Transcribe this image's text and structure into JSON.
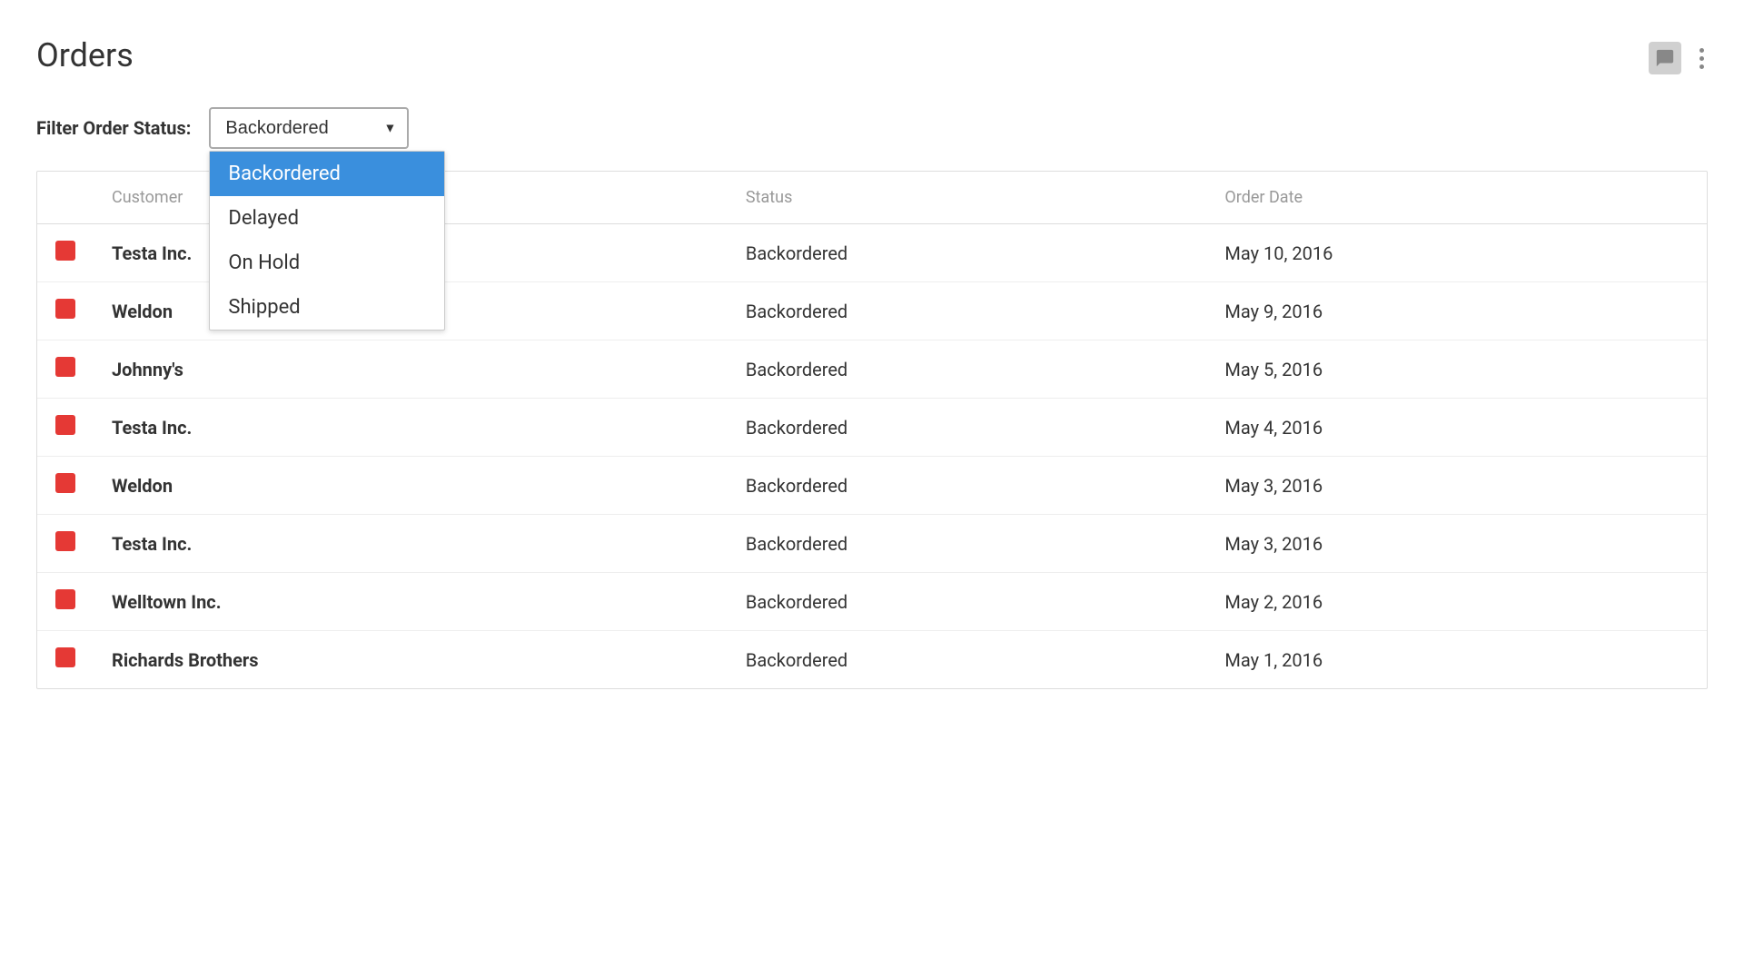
{
  "page": {
    "title": "Orders"
  },
  "header": {
    "chat_icon_label": "chat",
    "more_icon_label": "more options"
  },
  "filter": {
    "label": "Filter Order Status:",
    "selected_value": "Backordered",
    "options": [
      {
        "value": "Backordered",
        "label": "Backordered",
        "selected": true
      },
      {
        "value": "Delayed",
        "label": "Delayed",
        "selected": false
      },
      {
        "value": "On Hold",
        "label": "On Hold",
        "selected": false
      },
      {
        "value": "Shipped",
        "label": "Shipped",
        "selected": false
      }
    ]
  },
  "table": {
    "columns": [
      {
        "key": "indicator",
        "label": ""
      },
      {
        "key": "customer",
        "label": "Customer"
      },
      {
        "key": "status",
        "label": "Status"
      },
      {
        "key": "order_date",
        "label": "Order Date"
      }
    ],
    "rows": [
      {
        "customer": "Testa Inc.",
        "status": "Backordered",
        "order_date": "May 10, 2016"
      },
      {
        "customer": "Weldon",
        "status": "Backordered",
        "order_date": "May 9, 2016"
      },
      {
        "customer": "Johnny's",
        "status": "Backordered",
        "order_date": "May 5, 2016"
      },
      {
        "customer": "Testa Inc.",
        "status": "Backordered",
        "order_date": "May 4, 2016"
      },
      {
        "customer": "Weldon",
        "status": "Backordered",
        "order_date": "May 3, 2016"
      },
      {
        "customer": "Testa Inc.",
        "status": "Backordered",
        "order_date": "May 3, 2016"
      },
      {
        "customer": "Welltown Inc.",
        "status": "Backordered",
        "order_date": "May 2, 2016"
      },
      {
        "customer": "Richards Brothers",
        "status": "Backordered",
        "order_date": "May 1, 2016"
      }
    ]
  }
}
